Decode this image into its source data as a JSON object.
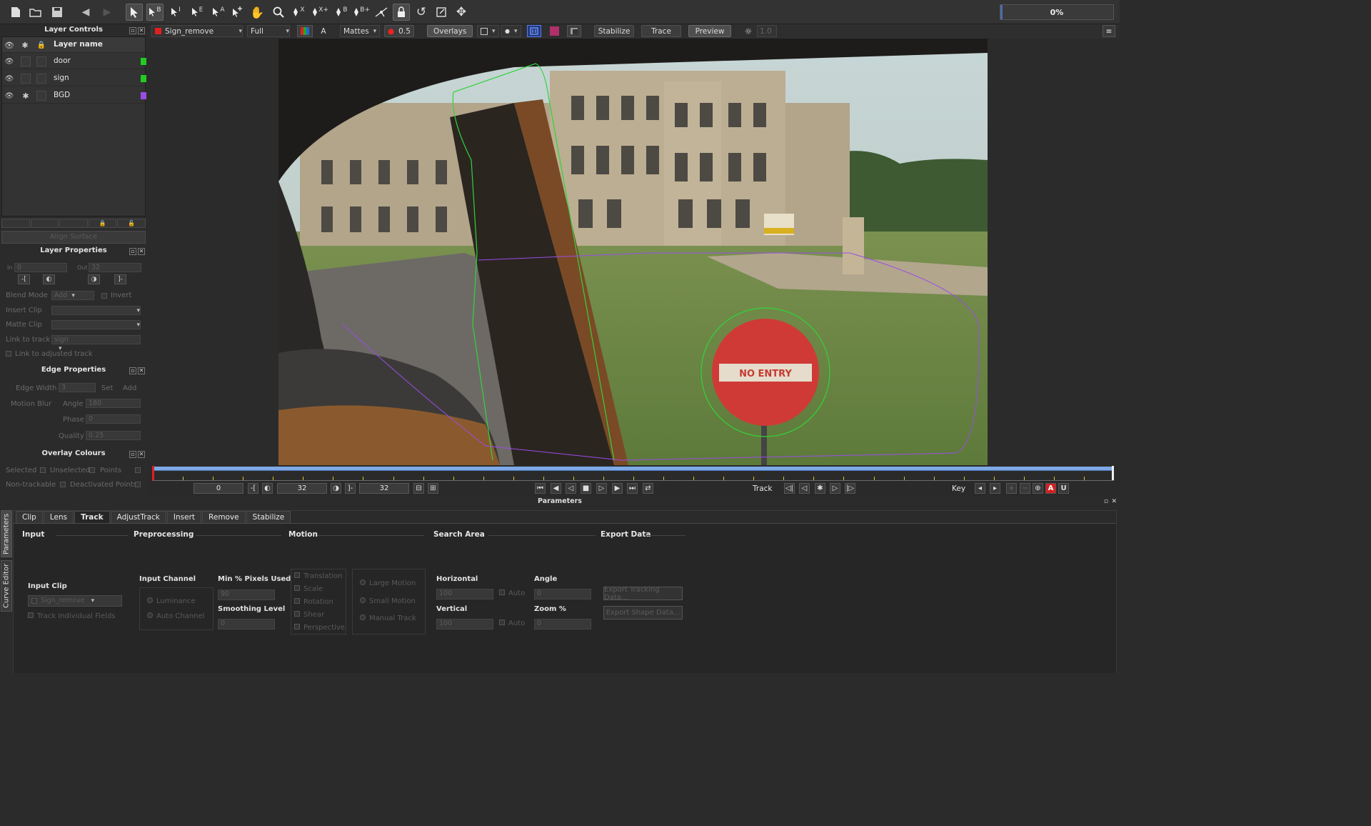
{
  "toolbar": {
    "tools": [
      "new-file",
      "open-folder",
      "save",
      "back",
      "forward",
      "select",
      "select-B",
      "select-I",
      "select-E",
      "select-A",
      "add-point",
      "hand",
      "zoom",
      "pen-X",
      "pen-X+",
      "pen-B",
      "pen-B+",
      "bezier",
      "lock",
      "rotate",
      "scale",
      "move"
    ],
    "labels": {
      "b": "B",
      "i": "I",
      "e": "E",
      "a": "A",
      "x": "X",
      "xplus": "X+",
      "bplus": "B+"
    },
    "progress": "0%"
  },
  "viewerbar": {
    "clip": "Sign_remove",
    "resolution": "Full",
    "mattes": "Mattes",
    "opacity": "0.5",
    "overlays": "Overlays",
    "stabilize": "Stabilize",
    "trace": "Trace",
    "preview": "Preview",
    "brightness": "1.0",
    "a_label": "A"
  },
  "layer_controls": {
    "title": "Layer Controls",
    "header": "Layer name",
    "layers": [
      {
        "name": "door",
        "color": "#22cc22"
      },
      {
        "name": "sign",
        "color": "#22cc22"
      },
      {
        "name": "BGD",
        "color": "#9a4de6"
      }
    ],
    "align_surface": "Align Surface"
  },
  "layer_properties": {
    "title": "Layer Properties",
    "in_label": "In",
    "in_value": "0",
    "out_label": "Out",
    "out_value": "32",
    "blend_mode_label": "Blend Mode",
    "blend_mode_value": "Add",
    "invert_label": "Invert",
    "insert_clip_label": "Insert Clip",
    "matte_clip_label": "Matte Clip",
    "link_to_track_label": "Link to track",
    "link_to_track_value": "sign",
    "link_adjusted_label": "Link to adjusted track"
  },
  "edge_properties": {
    "title": "Edge Properties",
    "edge_width_label": "Edge Width",
    "edge_width_value": "3",
    "set_label": "Set",
    "add_label": "Add",
    "motion_blur_label": "Motion Blur",
    "angle_label": "Angle",
    "angle_value": "180",
    "phase_label": "Phase",
    "phase_value": "0",
    "quality_label": "Quality",
    "quality_value": "0.25"
  },
  "overlay_colours": {
    "title": "Overlay Colours",
    "selected": "Selected",
    "unselected": "Unselected",
    "points": "Points",
    "non_trackable": "Non-trackable",
    "deactivated_points": "Deactivated Points"
  },
  "timeline": {
    "start": "0",
    "in": "32",
    "out": "32",
    "track_label": "Track",
    "key_label": "Key",
    "key_a": "A",
    "key_u": "U",
    "playhead_fraction": 0.0
  },
  "parameters": {
    "title": "Parameters",
    "side_tabs": [
      "Parameters",
      "Curve Editor"
    ],
    "tabs": [
      "Clip",
      "Lens",
      "Track",
      "AdjustTrack",
      "Insert",
      "Remove",
      "Stabilize"
    ],
    "active_tab": "Track",
    "sections": {
      "input": "Input",
      "preprocessing": "Preprocessing",
      "motion": "Motion",
      "search_area": "Search Area",
      "export_data": "Export Data"
    },
    "input_clip_label": "Input Clip",
    "input_clip_value": "Sign_remove",
    "track_individual_fields": "Track Individual Fields",
    "input_channel_label": "Input Channel",
    "luminance": "Luminance",
    "auto_channel": "Auto Channel",
    "min_pixels_label": "Min % Pixels Used",
    "min_pixels_value": "90",
    "smoothing_label": "Smoothing Level",
    "smoothing_value": "0",
    "motion_options": [
      "Translation",
      "Scale",
      "Rotation",
      "Shear",
      "Perspective"
    ],
    "motion_modes": [
      "Large Motion",
      "Small Motion",
      "Manual Track"
    ],
    "horizontal_label": "Horizontal",
    "horizontal_value": "100",
    "vertical_label": "Vertical",
    "vertical_value": "100",
    "auto_label": "Auto",
    "angle_label": "Angle",
    "angle_value": "0",
    "zoom_label": "Zoom %",
    "zoom_value": "0",
    "export_tracking": "Export Tracking Data...",
    "export_shape": "Export Shape Data..."
  },
  "viewer": {
    "sign_text": "NO ENTRY"
  }
}
